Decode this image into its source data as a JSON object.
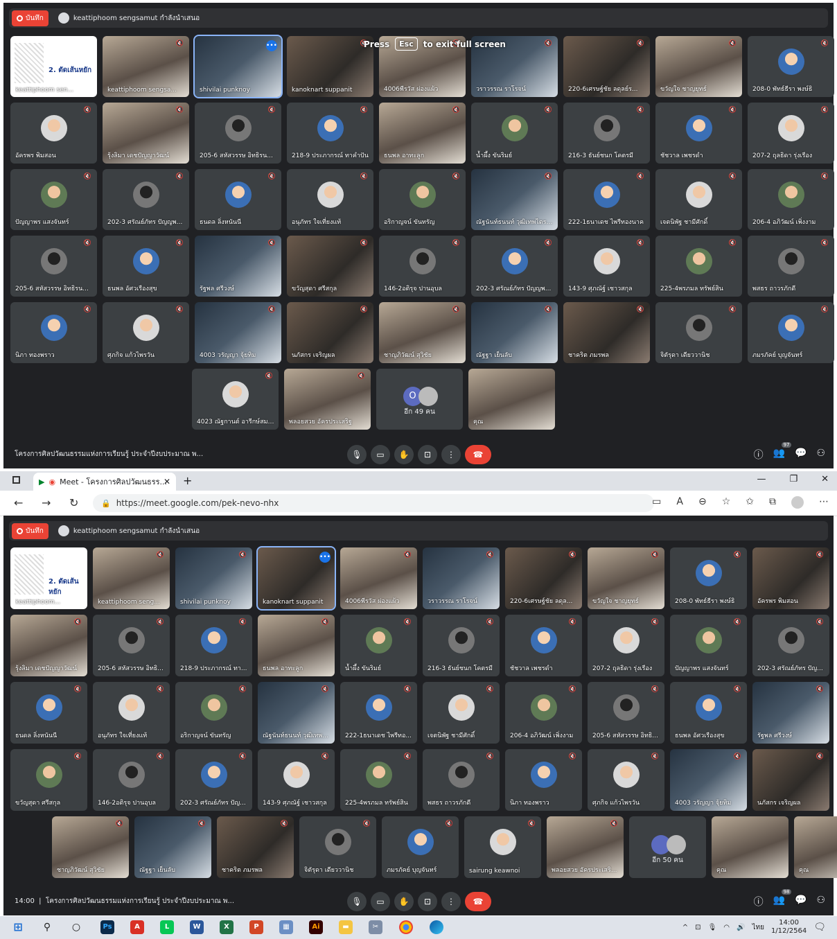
{
  "meet1": {
    "record_label": "บันทึก",
    "presenter": "keattiphoom sengsamut กำลังนำเสนอ",
    "esc_press": "Press",
    "esc_key": "Esc",
    "esc_msg": "to exit full screen",
    "slide_text": "2. ตัดเส้นหยัก",
    "tiles": [
      "keattiphoom sen...",
      "keattiphoom sengsa...",
      "shivilai punknoy",
      "kanoknart suppanit",
      "4006พีรวัส ผ่องแผ้ว",
      "วราวรรณ ราโรจน์",
      "220-6เศรษฐ์ชัย ลดุลย์ร...",
      "ขวัญใจ ชาญยุทธ์",
      "208-0 พัทธ์ธีรา พงษ์ธิ",
      "อัครพร พิมสอน",
      "รุ้งลิมา เดชปัญญาวัฒน์",
      "205-6 สหัสวรรษ อิทธิรน...",
      "218-9 ประภากรณ์ ทาคำปัน",
      "ธนพล อาทะลูก",
      "น้ำผึ้ง ขันริมย์",
      "216-3 ธันย์ชนก โคตรมี",
      "ชัชวาล เพชรดำ",
      "207-2 ฤุลธิดา รุ่งเรือง",
      "ปัญญาพร แสงจันทร์",
      "202-3 ศรัณย์ภัทร ปัญญพ...",
      "ธนดล ลิ่งหนันนี",
      "อนุภัทร ใจเที่ยงแท้",
      "อริกาญจน์ ขันทรัญ",
      "ณัฐนันท์ธนนท์ วุฒิเทพไตรทัย",
      "222-1ธนาเดช ไพรีทองนาค",
      "เจตนิพัฐ ชามีศักดิ์",
      "206-4 อภิวัฒน์ เพิ่งงาม",
      "205-6 สหัสวรรษ อิทธิรน...",
      "ธนพล อัศวเรืองสุข",
      "รัฐพล ศรีวงษ์",
      "ขวัญสุดา ศรีสกุล",
      "146-2อติรุจ ปานอุบล",
      "202-3 ศรัณย์ภัทร ปัญญพ...",
      "143-9 ศุภณัฐ์ เชาวสกุล",
      "225-4พรภมล ทรัพย์สิน",
      "พสธร ถาวรภักดี",
      "นิภา ทองพราว",
      "ศุภกิจ แก้วไพรวัน",
      "4003 วรัญญา จุ้ยทิม",
      "นภัสกร เจริญผล",
      "ชาญภิวัฒน์ สุวิชัย",
      "ณัฐฐา เย็นลับ",
      "ชาคริต ภมรพล",
      "จิตัรุดา เดียววานิช",
      "ภมรภัคย์ บุญจันทร์",
      "4023 ณัฐกานต์ อารีกษ์สมบูรณ์",
      "พลอยสวย อัครประเสริฐ"
    ],
    "more_label": "อีก 49 คน",
    "more_letter": "O",
    "last_tile": "คุณ",
    "meeting_name": "โครงการศิลปวัฒนธรรมแห่งการเรียนรู้ ประจำปีงบประมาณ พ...",
    "people_count": "97"
  },
  "browser": {
    "tab_title": "Meet - โครงการศิลปวัฒนธรร...",
    "url": "https://meet.google.com/pek-nevo-nhx"
  },
  "meet2": {
    "record_label": "บันทึก",
    "presenter": "keattiphoom sengsamut กำลังนำเสนอ",
    "slide_text": "2. ตัดเส้นหยัก",
    "tiles": [
      "keattiphoom...",
      "keattiphoom seng...",
      "shivilai punknoy",
      "kanoknart suppanit",
      "4006พีรวัส ผ่องแผ้ว",
      "วราวรรณ ราโรจน์",
      "220-6เศรษฐ์ชัย ลดุล...",
      "ขวัญใจ ชาญยุทธ์",
      "208-0 พัทธ์ธีรา พงษ์ธิ",
      "อัครพร พิมสอน",
      "รุ้งลิมา เดชปัญญาวัฒน์",
      "205-6 สหัสวรรษ อิทธิ...",
      "218-9 ประภากรณ์ ทา...",
      "ธนพล อาทะลูก",
      "น้ำผึ้ง ขันริมย์",
      "216-3 ธันย์ชนก โคตรมี",
      "ชัชวาล เพชรดำ",
      "207-2 ฤุลธิดา รุ่งเรือง",
      "ปัญญาพร แสงจันทร์",
      "202-3 ศรัณย์ภัทร ปัญ...",
      "ธนดล ลิ่งหนันนี",
      "อนุภัทร ใจเที่ยงแท้",
      "อริกาญจน์ ขันทรัญ",
      "ณัฐนันท์ธนนท์ วุฒิเทพไ...",
      "222-1ธนาเดช ไพรีทอ...",
      "เจตนิพัฐ ชามีศักดิ์",
      "206-4 อภิวัฒน์ เพิ่งงาม",
      "205-6 สหัสวรรษ อิทธิ...",
      "ธนพล อัศวเรืองสุข",
      "รัฐพล ศรีวงษ์",
      "ขวัญสุดา ศรีสกุล",
      "146-2อติรุจ ปานอุบล",
      "202-3 ศรัณย์ภัทร ปัญ...",
      "143-9 ศุภณัฐ์ เชาวสกุล",
      "225-4พรภมล ทรัพย์สิน",
      "พสธร ถาวรภักดี",
      "นิภา ทองพราว",
      "ศุภกิจ แก้วไพรวัน",
      "4003 วรัญญา จุ้ยทิม",
      "นภัสกร เจริญผล",
      "ชาญภิวัฒน์ สุวิชัย",
      "ณัฐฐา เย็นลับ",
      "ชาคริต ภมรพล",
      "จิตัรุดา เดียววานิช",
      "ภมรภัคย์ บุญจันทร์",
      "sairung keawnoi",
      "พลอยสวย อัครประเสริ..."
    ],
    "more_label": "อีก 50 คน",
    "last_tile": "คุณ",
    "time": "14:00",
    "meeting_name": "โครงการศิลปวัฒนธรรมแห่งการเรียนรู้ ประจำปีงบประมาณ พ...",
    "people_count": "98"
  },
  "taskbar": {
    "lang": "ไทย",
    "time": "14:00",
    "date": "1/12/2564",
    "apps": [
      "Ps",
      "W",
      "X",
      "P",
      "Ai"
    ]
  }
}
